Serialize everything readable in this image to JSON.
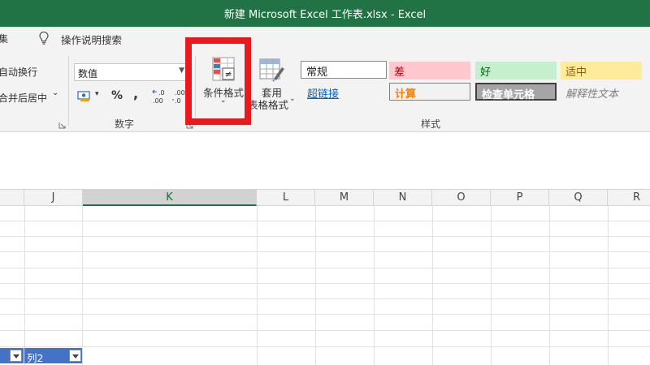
{
  "window": {
    "title": "新建 Microsoft Excel 工作表.xlsx  -  Excel"
  },
  "tellbar": {
    "cut_tab": "集",
    "tell_me": "操作说明搜索"
  },
  "ribbon": {
    "alignment": {
      "wrap_text": "自动换行",
      "merge_center": "合并后居中",
      "merge_caret": "⌄"
    },
    "number": {
      "format_value": "数值",
      "percent": "%",
      "comma": ",",
      "group_label": "数字"
    },
    "conditional_formatting": {
      "label": "条件格式",
      "caret": "⌄"
    },
    "format_as_table": {
      "label_line1": "套用",
      "label_line2": "表格格式",
      "caret": "⌄"
    },
    "styles": {
      "group_label": "样式",
      "normal": "常规",
      "bad": "差",
      "good": "好",
      "neutral": "适中",
      "hyperlink": "超链接",
      "calculation": "计算",
      "check_cell": "检查单元格",
      "explanatory": "解释性文本"
    }
  },
  "columns": [
    "J",
    "K",
    "L",
    "M",
    "N",
    "O",
    "P",
    "Q",
    "R"
  ],
  "table": {
    "header_label": "列2"
  },
  "colors": {
    "accent": "#217346",
    "highlight": "#e8191f",
    "table_header": "#4472c4"
  },
  "icons": [
    "lightbulb-icon",
    "conditional-formatting-icon",
    "format-as-table-icon",
    "currency-icon",
    "increase-decimal-icon",
    "decrease-decimal-icon",
    "filter-dropdown-icon"
  ]
}
